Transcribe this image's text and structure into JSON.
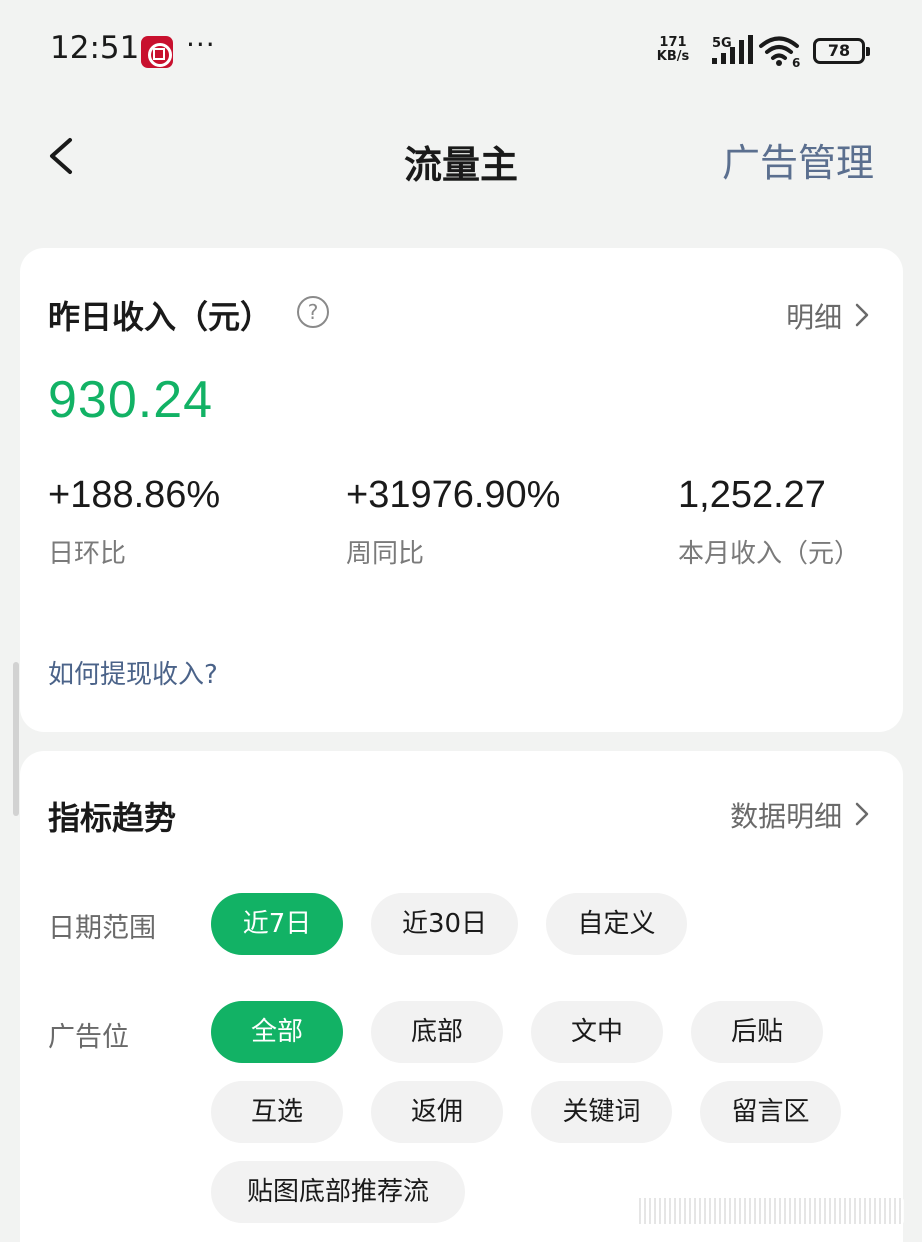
{
  "status_bar": {
    "time": "12:51",
    "more": "···",
    "net_speed_value": "171",
    "net_speed_unit": "KB/s",
    "network": "5G",
    "wifi_badge": "6",
    "battery": "78"
  },
  "header": {
    "title": "流量主",
    "ad_manage": "广告管理"
  },
  "income": {
    "title": "昨日收入（元）",
    "help": "?",
    "detail_link": "明细",
    "value": "930.24",
    "stats": {
      "day_value": "+188.86%",
      "day_label": "日环比",
      "week_value": "+31976.90%",
      "week_label": "周同比",
      "month_value": "1,252.27",
      "month_label": "本月收入（元）"
    },
    "withdraw_link": "如何提现收入?"
  },
  "trend": {
    "title": "指标趋势",
    "data_detail_link": "数据明细",
    "date_range_label": "日期范围",
    "date_chips": [
      "近7日",
      "近30日",
      "自定义"
    ],
    "date_selected": "近7日",
    "ad_position_label": "广告位",
    "ad_chips": [
      "全部",
      "底部",
      "文中",
      "后贴",
      "互选",
      "返佣",
      "关键词",
      "留言区",
      "贴图底部推荐流"
    ],
    "ad_selected": "全部"
  },
  "colors": {
    "accent_green": "#12b265",
    "link_blue": "#4b6389",
    "header_link": "#5b6f8f"
  }
}
